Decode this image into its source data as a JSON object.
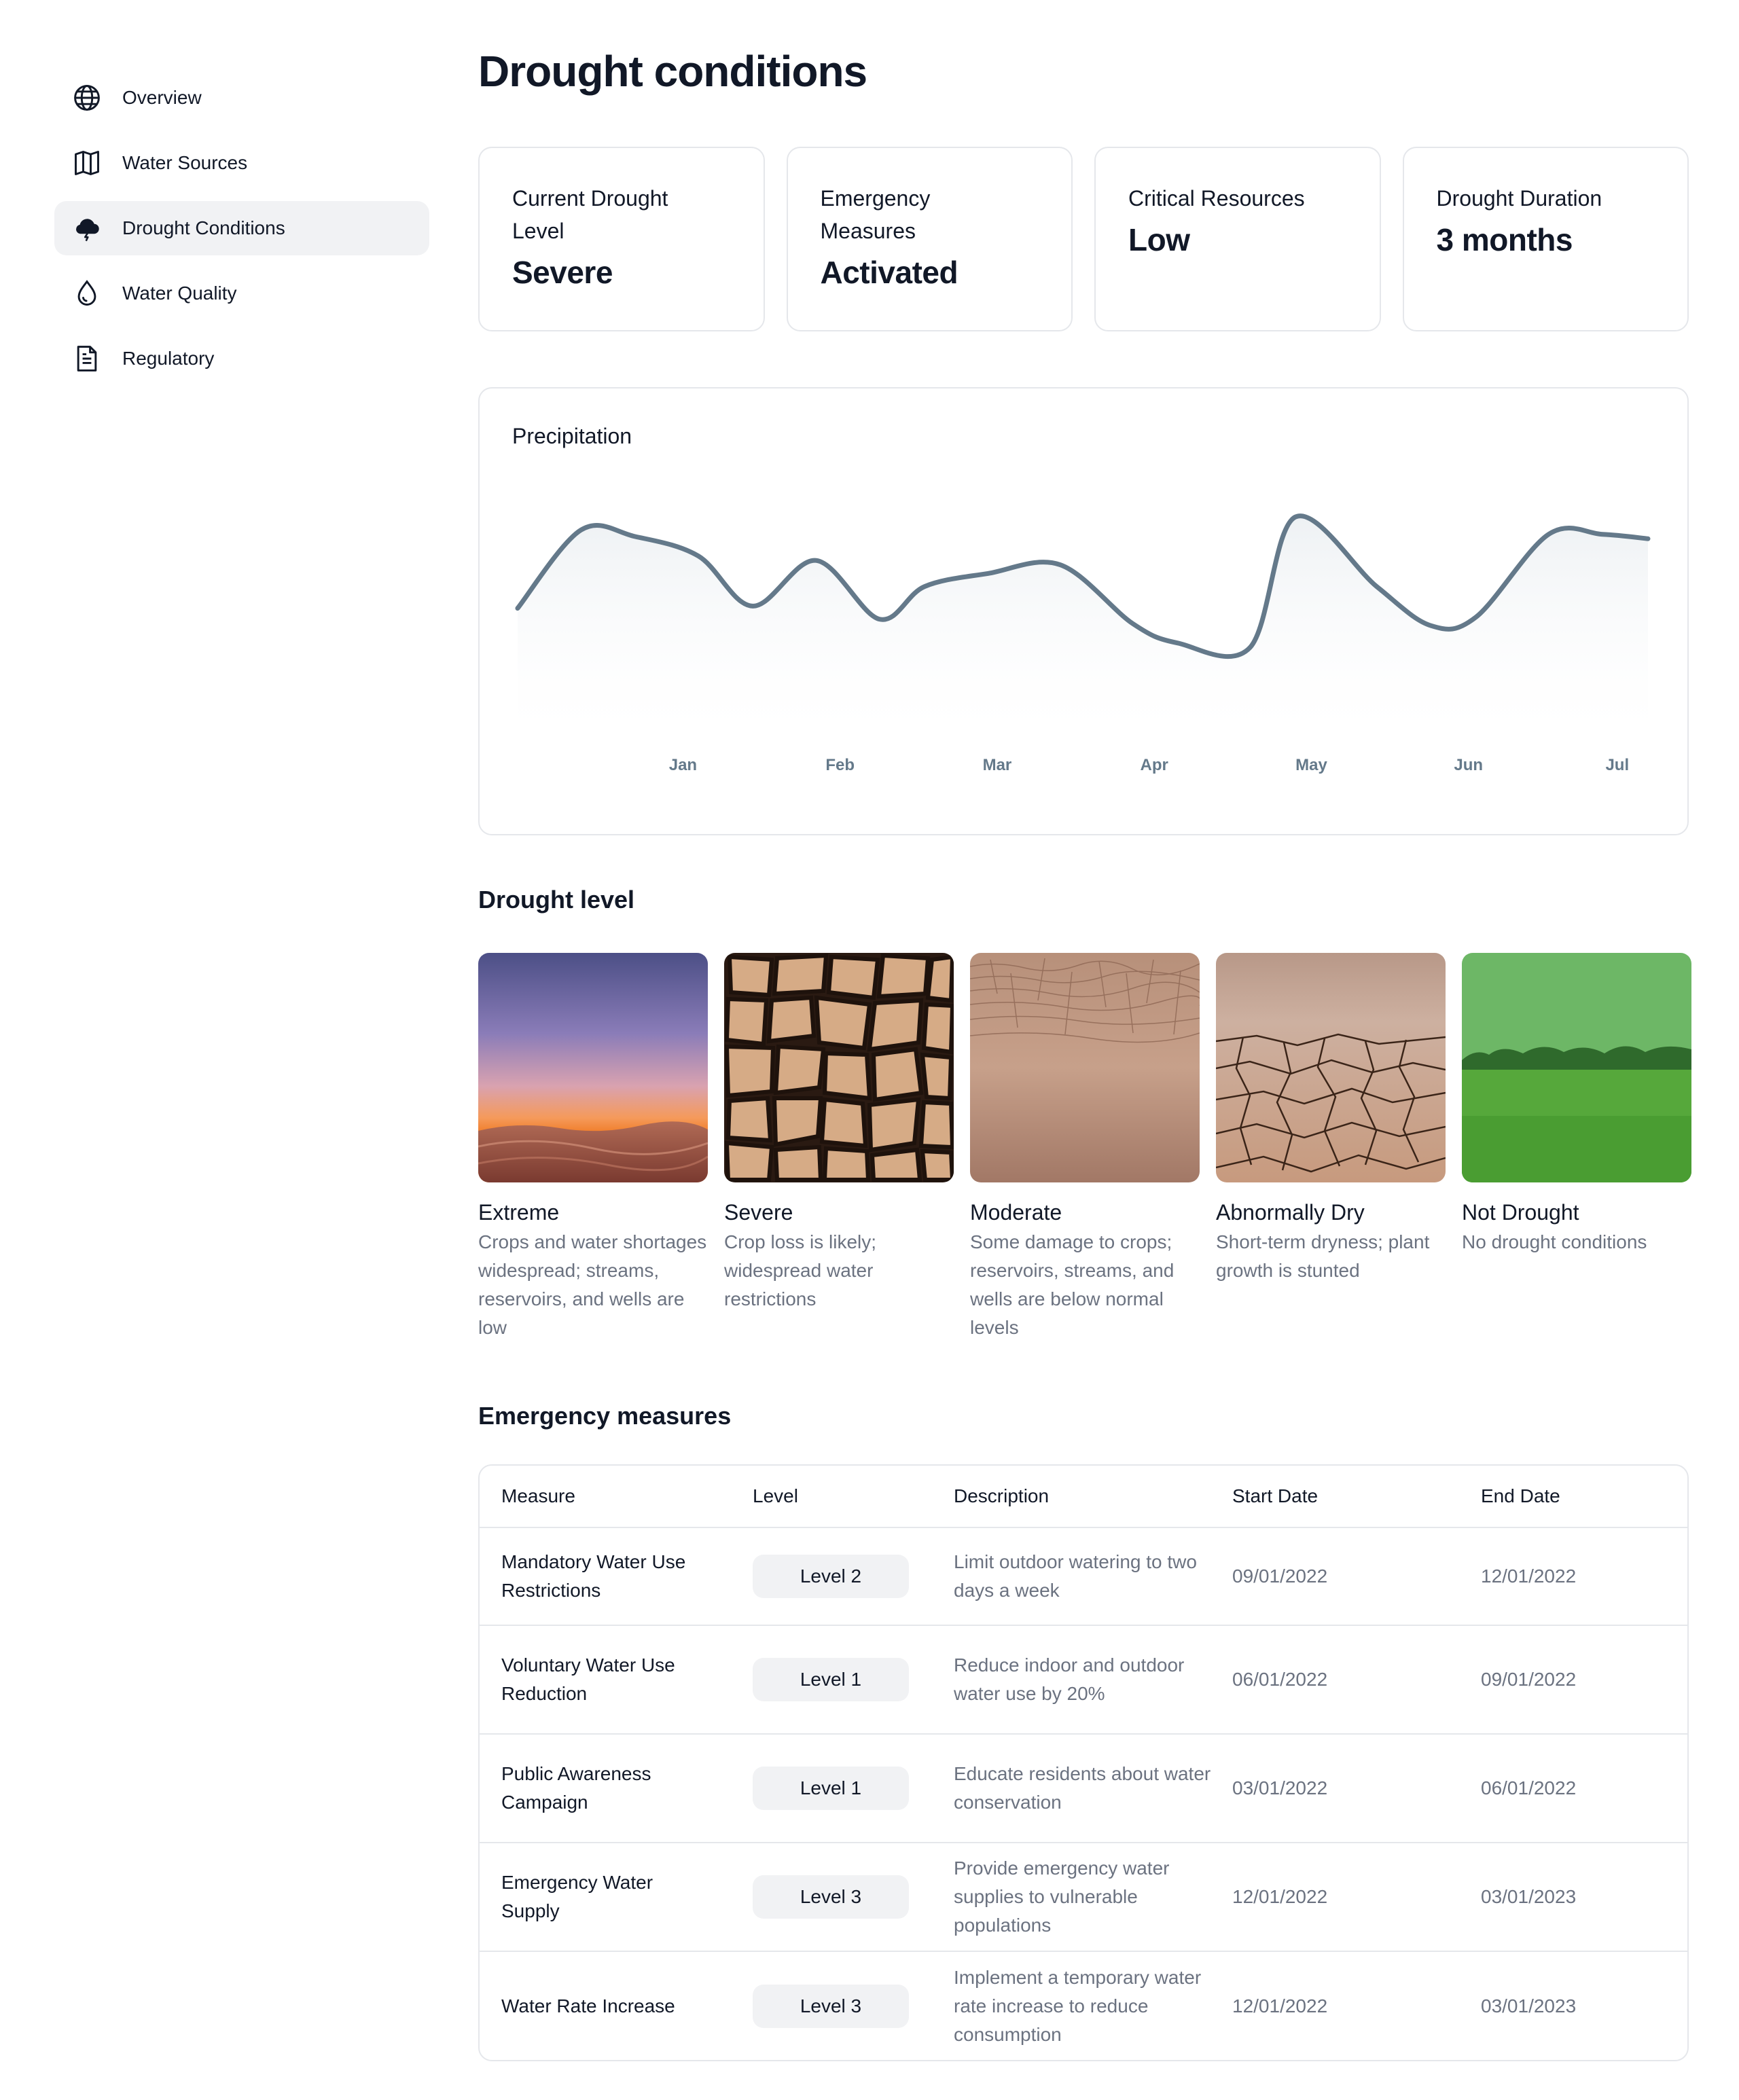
{
  "sidebar": {
    "items": [
      {
        "label": "Overview",
        "icon": "globe-icon",
        "active": false
      },
      {
        "label": "Water Sources",
        "icon": "map-icon",
        "active": false
      },
      {
        "label": "Drought Conditions",
        "icon": "storm-cloud-icon",
        "active": true
      },
      {
        "label": "Water Quality",
        "icon": "droplet-icon",
        "active": false
      },
      {
        "label": "Regulatory",
        "icon": "document-icon",
        "active": false
      }
    ]
  },
  "page": {
    "title": "Drought conditions"
  },
  "stats": [
    {
      "label": "Current Drought Level",
      "value": "Severe"
    },
    {
      "label": "Emergency Measures",
      "value": "Activated"
    },
    {
      "label": "Critical Resources",
      "value": "Low"
    },
    {
      "label": "Drought Duration",
      "value": "3 months"
    }
  ],
  "chart_data": {
    "type": "area",
    "title": "Precipitation",
    "categories": [
      "Jan",
      "Feb",
      "Mar",
      "Apr",
      "May",
      "Jun",
      "Jul"
    ],
    "x": [
      0,
      0.35,
      0.65,
      1.0,
      1.3,
      1.65,
      2.0,
      2.25,
      2.6,
      3.0,
      3.4,
      3.65,
      4.05,
      4.3,
      4.75,
      5.05,
      5.3,
      5.7,
      6.0,
      6.25
    ],
    "values": [
      52,
      88,
      85,
      76,
      53,
      74,
      47,
      62,
      68,
      72,
      45,
      36,
      34,
      94,
      62,
      44,
      48,
      86,
      86,
      84
    ],
    "color": "#64798a",
    "grid": false,
    "xlabel": "",
    "ylabel": ""
  },
  "drought_level": {
    "title": "Drought level",
    "levels": [
      {
        "title": "Extreme",
        "desc": "Crops and water shortages widespread; streams, reservoirs, and wells are low",
        "image": "desert-dunes-sunset"
      },
      {
        "title": "Severe",
        "desc": "Crop loss is likely; widespread water restrictions",
        "image": "deeply-cracked-earth"
      },
      {
        "title": "Moderate",
        "desc": "Some damage to crops; reservoirs, streams, and wells are below normal levels",
        "image": "dry-lakebed"
      },
      {
        "title": "Abnormally Dry",
        "desc": "Short-term dryness; plant growth is stunted",
        "image": "cracked-soil"
      },
      {
        "title": "Not Drought",
        "desc": "No drought conditions",
        "image": "green-field"
      }
    ]
  },
  "emergency": {
    "title": "Emergency measures",
    "columns": [
      "Measure",
      "Level",
      "Description",
      "Start Date",
      "End Date"
    ],
    "rows": [
      {
        "measure": "Mandatory Water Use Restrictions",
        "level": "Level 2",
        "desc": "Limit outdoor watering to two days a week",
        "start": "09/01/2022",
        "end": "12/01/2022"
      },
      {
        "measure": "Voluntary Water Use Reduction",
        "level": "Level 1",
        "desc": "Reduce indoor and outdoor water use by 20%",
        "start": "06/01/2022",
        "end": "09/01/2022"
      },
      {
        "measure": "Public Awareness Campaign",
        "level": "Level 1",
        "desc": "Educate residents about water conservation",
        "start": "03/01/2022",
        "end": "06/01/2022"
      },
      {
        "measure": "Emergency Water Supply",
        "level": "Level 3",
        "desc": "Provide emergency water supplies to vulnerable populations",
        "start": "12/01/2022",
        "end": "03/01/2023"
      },
      {
        "measure": "Water Rate Increase",
        "level": "Level 3",
        "desc": "Implement a temporary water rate increase to reduce consumption",
        "start": "12/01/2022",
        "end": "03/01/2023"
      }
    ]
  }
}
